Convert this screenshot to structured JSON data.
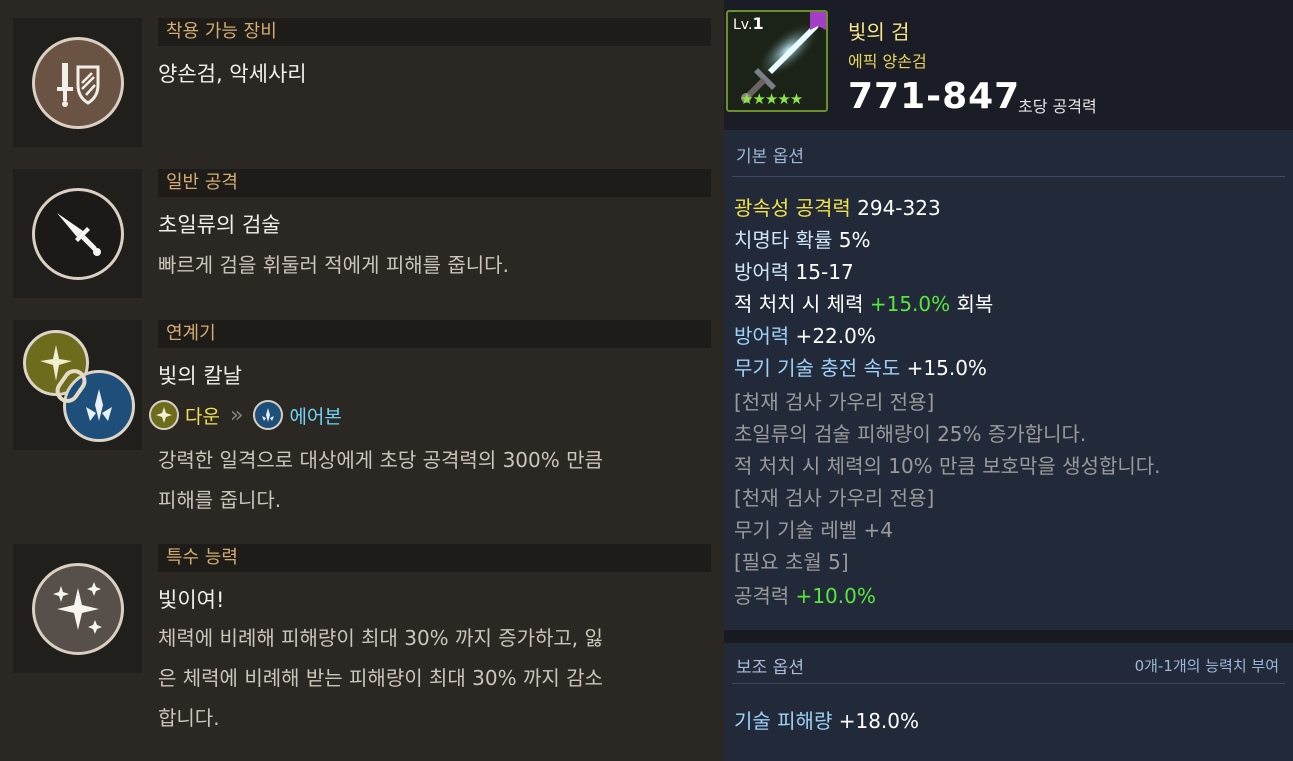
{
  "skills": [
    {
      "category": "착용 가능 장비",
      "name": "양손검, 악세사리",
      "icon": "sword-shield-icon",
      "desc": []
    },
    {
      "category": "일반 공격",
      "name": "초일류의 검술",
      "icon": "sword-icon",
      "desc": [
        "빠르게 검을 휘둘러 적에게 피해를 줍니다."
      ]
    },
    {
      "category": "연계기",
      "name": "빛의 칼날",
      "icon": "chain-link-icon",
      "combo_from": "다운",
      "combo_arrow": "»",
      "combo_to": "에어본",
      "desc": [
        "강력한 일격으로 대상에게 초당 공격력의 300% 만큼",
        "피해를 줍니다."
      ]
    },
    {
      "category": "특수 능력",
      "name": "빛이여!",
      "icon": "sparkle-icon",
      "desc": [
        "체력에 비례해 피해량이 최대 30% 까지 증가하고, 잃",
        "은 체력에 비례해 받는 피해량이 최대 30% 까지 감소",
        "합니다."
      ]
    }
  ],
  "item": {
    "level_prefix": "Lv.",
    "level": "1",
    "stars": "★★★★★",
    "name": "빛의 검",
    "grade": "에픽 양손검",
    "attack": "771-847",
    "attack_label": "초당 공격력"
  },
  "basic": {
    "title": "기본 옵션",
    "lines": [
      {
        "a": "광속성 공격력",
        "b": " 294-323"
      },
      {
        "a": "치명타 확률",
        "b": " 5%"
      },
      {
        "a": "방어력",
        "b": " 15-17"
      },
      {
        "a": "적 처치 시 체력",
        "b": " +15.0%",
        "c": " 회복"
      },
      {
        "a": "방어력",
        "b": " +22.0%"
      },
      {
        "a": "무기 기술 충전 속도",
        "b": " +15.0%"
      },
      {
        "a": "[천재 검사 가우리 전용]"
      },
      {
        "a": "초일류의 검술 피해량이 25% 증가합니다."
      },
      {
        "a": "적 처치 시 체력의 10% 만큼 보호막을 생성합니다."
      },
      {
        "a": "[천재 검사 가우리 전용]"
      },
      {
        "a": "무기 기술 레벨 +4"
      },
      {
        "a": "[필요 초월 5]"
      },
      {
        "a": "공격력",
        "b": " +10.0%"
      }
    ]
  },
  "sub": {
    "title": "보조 옵션",
    "note": "0개-1개의 능력치 부여",
    "line_a": "기술 피해량",
    "line_b": " +18.0%"
  },
  "colors": {
    "gold": "#d3ac72",
    "yellow": "#f3e04a",
    "green": "#57e63d",
    "blue": "#9ed1f7"
  }
}
